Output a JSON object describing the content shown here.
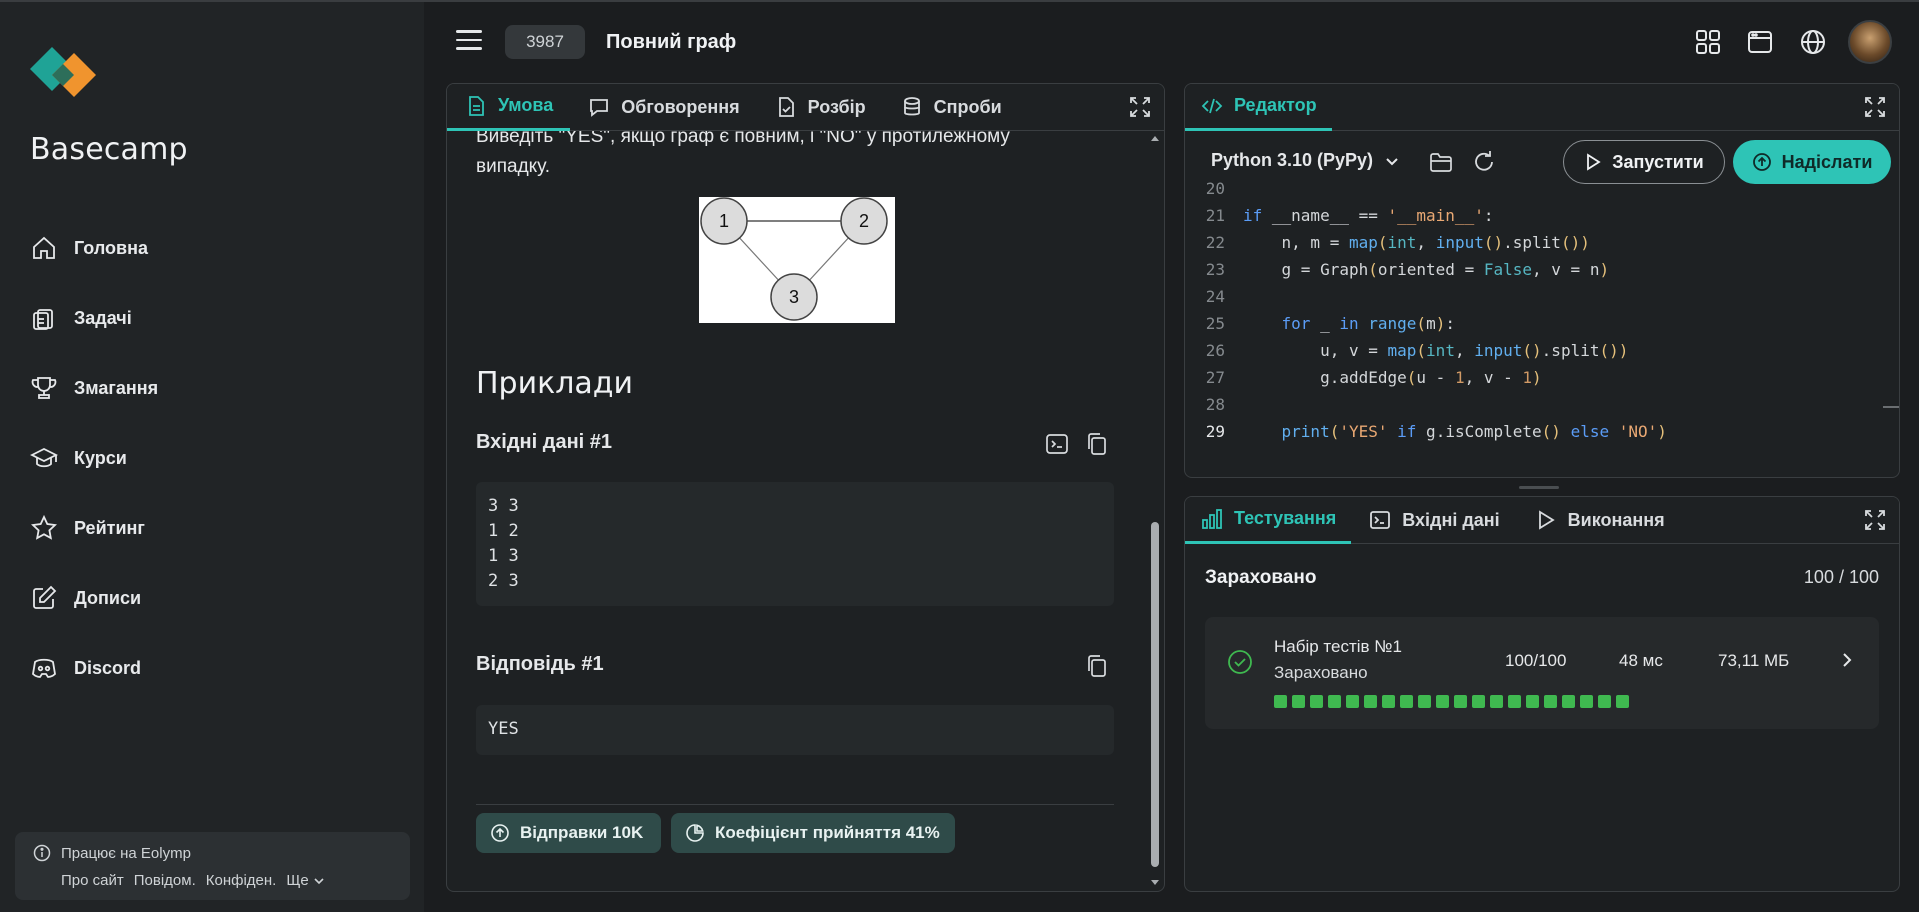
{
  "sidebar": {
    "brand": "Basecamp",
    "items": [
      {
        "label": "Головна",
        "icon": "home-icon"
      },
      {
        "label": "Задачі",
        "icon": "clipboard-icon"
      },
      {
        "label": "Змагання",
        "icon": "trophy-icon"
      },
      {
        "label": "Курси",
        "icon": "graduation-cap-icon"
      },
      {
        "label": "Рейтинг",
        "icon": "star-icon"
      },
      {
        "label": "Дописи",
        "icon": "edit-icon"
      },
      {
        "label": "Discord",
        "icon": "discord-icon"
      }
    ],
    "footer": {
      "title": "Працює на Eolymp",
      "links": [
        "Про сайт",
        "Повідом.",
        "Конфіден.",
        "Ще"
      ]
    }
  },
  "header": {
    "problem_id": "3987",
    "problem_title": "Повний граф"
  },
  "statement": {
    "tabs": [
      "Умова",
      "Обговорення",
      "Розбір",
      "Спроби"
    ],
    "text_line1": "Виведіть \"YES\", якщо граф є повним, і \"NO\" у протилежному",
    "text_line2": "випадку.",
    "graph_nodes": [
      "1",
      "2",
      "3"
    ],
    "examples_heading": "Приклади",
    "input_heading": "Вхідні дані #1",
    "input_lines": "3 3\n1 2\n1 3\n2 3",
    "answer_heading": "Відповідь #1",
    "answer_value": "YES",
    "stats": {
      "submissions": "Відправки 10K",
      "acceptance": "Коефіцієнт прийняття 41%"
    }
  },
  "editor": {
    "tab": "Редактор",
    "language": "Python 3.10 (PyPy)",
    "run_label": "Запустити",
    "submit_label": "Надіслати",
    "line_numbers": [
      "20",
      "21",
      "22",
      "23",
      "24",
      "25",
      "26",
      "27",
      "28",
      "29"
    ],
    "code": [
      "",
      "if __name__ == '__main__':",
      "    n, m = map(int, input().split())",
      "    g = Graph(oriented = False, v = n)",
      "",
      "    for _ in range(m):",
      "        u, v = map(int, input().split())",
      "        g.addEdge(u - 1, v - 1)",
      "",
      "    print('YES' if g.isComplete() else 'NO')"
    ]
  },
  "testing": {
    "tabs": [
      "Тестування",
      "Вхідні дані",
      "Виконання"
    ],
    "verdict": "Зараховано",
    "score": "100 / 100",
    "testset": {
      "title": "Набір тестів №1",
      "status": "Зараховано",
      "points": "100/100",
      "time": "48 мс",
      "memory": "73,11 МБ",
      "passed_tests": 20
    }
  },
  "colors": {
    "accent": "#2ec4b6",
    "pass": "#3fb950",
    "background": "#1b1d1f"
  }
}
